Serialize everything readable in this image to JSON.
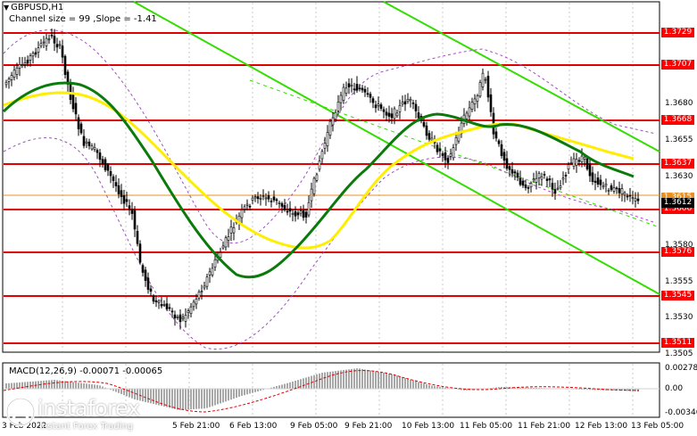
{
  "header": {
    "symbol_timeframe": "GBPUSD,H1",
    "indicator_line": "Channel size = 99 ,Slope = -1.41"
  },
  "macd_panel": {
    "label": "MACD(12,26,9) -0.00071 -0.00065",
    "scale": [
      "0.00278",
      "0.00",
      "-0.00346"
    ]
  },
  "price_axis": {
    "labels": [
      "1.3680",
      "1.3655",
      "1.3630",
      "1.3580",
      "1.3555",
      "1.3530",
      "1.3505"
    ]
  },
  "level_tags": [
    "1.3729",
    "1.3707",
    "1.3668",
    "1.3637",
    "1.3615",
    "1.3606",
    "1.3576",
    "1.3545",
    "1.3511"
  ],
  "current_price": "1.3612",
  "time_axis": [
    "3 Feb 2022",
    "5 Feb 21:00",
    "6 Feb 13:00",
    "9 Feb 05:00",
    "9 Feb 21:00",
    "10 Feb 13:00",
    "11 Feb 05:00",
    "11 Feb 21:00",
    "12 Feb 13:00",
    "13 Feb 05:00"
  ],
  "watermark": {
    "brand": "instaforex",
    "tagline": "Instant Forex Trading"
  },
  "colors": {
    "level_line": "#e00000",
    "channel": "#33dd00",
    "ma_fast": "#0a7a0a",
    "ma_slow": "#ffee00",
    "envelope": "#a050c0",
    "candle": "#000000"
  }
}
